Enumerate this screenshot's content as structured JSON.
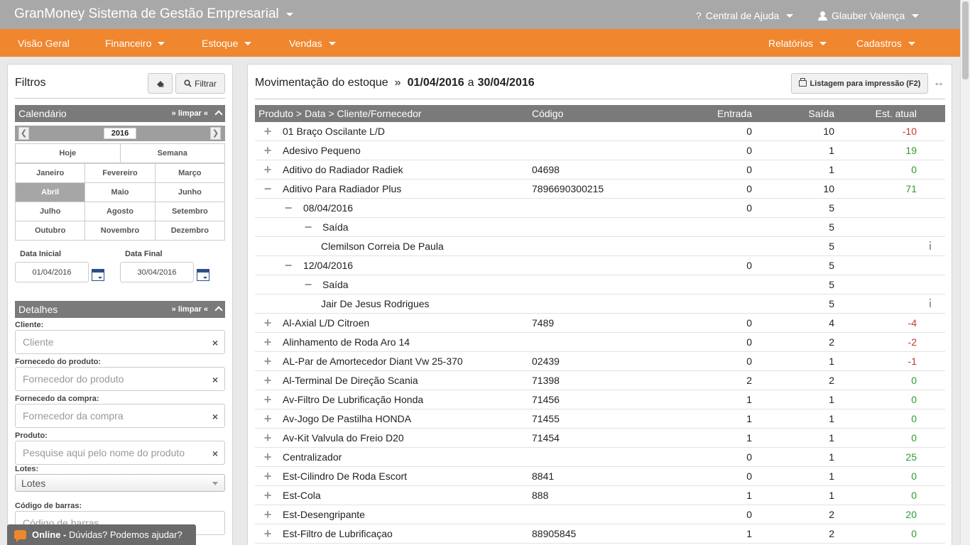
{
  "app": {
    "title": "GranMoney Sistema de Gestão Empresarial",
    "help_label": "Central de Ajuda",
    "help_prefix": "?",
    "user_name": "Glauber Valença"
  },
  "nav": {
    "items": [
      "Visão Geral",
      "Financeiro",
      "Estoque",
      "Vendas"
    ],
    "right_items": [
      "Relatórios",
      "Cadastros"
    ]
  },
  "filters": {
    "title": "Filtros",
    "filter_button": "Filtrar",
    "calendar": {
      "title": "Calendário",
      "clear": "» limpar «",
      "year": "2016",
      "quick": [
        "Hoje",
        "Semana"
      ],
      "months": [
        "Janeiro",
        "Fevereiro",
        "Março",
        "Abril",
        "Maio",
        "Junho",
        "Julho",
        "Agosto",
        "Setembro",
        "Outubro",
        "Novembro",
        "Dezembro"
      ],
      "selected_month": "Abril",
      "start_label": "Data Inicial",
      "start_value": "01/04/2016",
      "end_label": "Data Final",
      "end_value": "30/04/2016"
    },
    "details": {
      "title": "Detalhes",
      "clear": "» limpar «",
      "cliente_label": "Cliente:",
      "cliente_placeholder": "Cliente",
      "fornecedor_produto_label": "Fornecedo do produto:",
      "fornecedor_produto_placeholder": "Fornecedor do produto",
      "fornecedor_compra_label": "Fornecedo da compra:",
      "fornecedor_compra_placeholder": "Fornecedor da compra",
      "produto_label": "Produto:",
      "produto_placeholder": "Pesquise aqui pelo nome do produto",
      "lotes_label": "Lotes:",
      "lotes_value": "Lotes",
      "barcode_label": "Código de barras:",
      "barcode_placeholder": "Código de barras"
    }
  },
  "chat": {
    "status": "Online -",
    "message": "Dúvidas? Podemos ajudar?"
  },
  "report": {
    "title": "Movimentação do estoque",
    "separator": "»",
    "date_from": "01/04/2016",
    "date_conj": "a",
    "date_to": "30/04/2016",
    "print_button": "Listagem para impressão (F2)",
    "columns": {
      "product": "Produto > Data > Cliente/Fornecedor",
      "code": "Código",
      "entrada": "Entrada",
      "saida": "Saída",
      "estoque": "Est. atual"
    },
    "rows": [
      {
        "level": 0,
        "toggle": "+",
        "name": "01 Braço Oscilante L/D",
        "code": "",
        "entrada": "0",
        "saida": "10",
        "estoque": "-10",
        "status": "neg"
      },
      {
        "level": 0,
        "toggle": "+",
        "name": "Adesivo Pequeno",
        "code": "",
        "entrada": "0",
        "saida": "1",
        "estoque": "19",
        "status": "pos"
      },
      {
        "level": 0,
        "toggle": "+",
        "name": "Aditivo do Radiador Radiek",
        "code": "04698",
        "entrada": "0",
        "saida": "1",
        "estoque": "0",
        "status": "pos"
      },
      {
        "level": 0,
        "toggle": "−",
        "name": "Aditivo Para Radiador Plus",
        "code": "7896690300215",
        "entrada": "0",
        "saida": "10",
        "estoque": "71",
        "status": "pos"
      },
      {
        "level": 1,
        "toggle": "−",
        "name": "08/04/2016",
        "code": "",
        "entrada": "0",
        "saida": "5",
        "estoque": "",
        "status": ""
      },
      {
        "level": 2,
        "toggle": "−",
        "name": "Saída",
        "code": "",
        "entrada": "",
        "saida": "5",
        "estoque": "",
        "status": ""
      },
      {
        "level": 3,
        "toggle": "",
        "name": "Clemilson Correia De Paula",
        "code": "",
        "entrada": "",
        "saida": "5",
        "estoque": "",
        "status": "",
        "info": true
      },
      {
        "level": 1,
        "toggle": "−",
        "name": "12/04/2016",
        "code": "",
        "entrada": "0",
        "saida": "5",
        "estoque": "",
        "status": ""
      },
      {
        "level": 2,
        "toggle": "−",
        "name": "Saída",
        "code": "",
        "entrada": "",
        "saida": "5",
        "estoque": "",
        "status": ""
      },
      {
        "level": 3,
        "toggle": "",
        "name": "Jair De Jesus Rodrigues",
        "code": "",
        "entrada": "",
        "saida": "5",
        "estoque": "",
        "status": "",
        "info": true
      },
      {
        "level": 0,
        "toggle": "+",
        "name": "Al-Axial L/D Citroen",
        "code": "7489",
        "entrada": "0",
        "saida": "4",
        "estoque": "-4",
        "status": "neg"
      },
      {
        "level": 0,
        "toggle": "+",
        "name": "Alinhamento de Roda Aro 14",
        "code": "",
        "entrada": "0",
        "saida": "2",
        "estoque": "-2",
        "status": "neg"
      },
      {
        "level": 0,
        "toggle": "+",
        "name": "AL-Par de Amortecedor Diant Vw 25-370",
        "code": "02439",
        "entrada": "0",
        "saida": "1",
        "estoque": "-1",
        "status": "neg"
      },
      {
        "level": 0,
        "toggle": "+",
        "name": "Al-Terminal De Direção Scania",
        "code": "71398",
        "entrada": "2",
        "saida": "2",
        "estoque": "0",
        "status": "pos"
      },
      {
        "level": 0,
        "toggle": "+",
        "name": "Av-Filtro De Lubrificação Honda",
        "code": "71456",
        "entrada": "1",
        "saida": "1",
        "estoque": "0",
        "status": "pos"
      },
      {
        "level": 0,
        "toggle": "+",
        "name": "Av-Jogo De Pastilha HONDA",
        "code": "71455",
        "entrada": "1",
        "saida": "1",
        "estoque": "0",
        "status": "pos"
      },
      {
        "level": 0,
        "toggle": "+",
        "name": "Av-Kit Valvula do Freio D20",
        "code": "71454",
        "entrada": "1",
        "saida": "1",
        "estoque": "0",
        "status": "pos"
      },
      {
        "level": 0,
        "toggle": "+",
        "name": "Centralizador",
        "code": "",
        "entrada": "0",
        "saida": "1",
        "estoque": "25",
        "status": "pos"
      },
      {
        "level": 0,
        "toggle": "+",
        "name": "Est-Cilindro De Roda Escort",
        "code": "8841",
        "entrada": "0",
        "saida": "1",
        "estoque": "0",
        "status": "pos"
      },
      {
        "level": 0,
        "toggle": "+",
        "name": "Est-Cola",
        "code": "888",
        "entrada": "1",
        "saida": "1",
        "estoque": "0",
        "status": "pos"
      },
      {
        "level": 0,
        "toggle": "+",
        "name": "Est-Desengripante",
        "code": "",
        "entrada": "0",
        "saida": "2",
        "estoque": "20",
        "status": "pos"
      },
      {
        "level": 0,
        "toggle": "+",
        "name": "Est-Filtro de Lubrificaçao",
        "code": "88905845",
        "entrada": "1",
        "saida": "2",
        "estoque": "0",
        "status": "pos"
      }
    ]
  },
  "colors": {
    "nav_orange": "#f0862e",
    "topbar_gray": "#a8a8a8",
    "header_gray": "#7a7a7a",
    "negative": "#c0392b",
    "positive": "#2f9a2f"
  }
}
